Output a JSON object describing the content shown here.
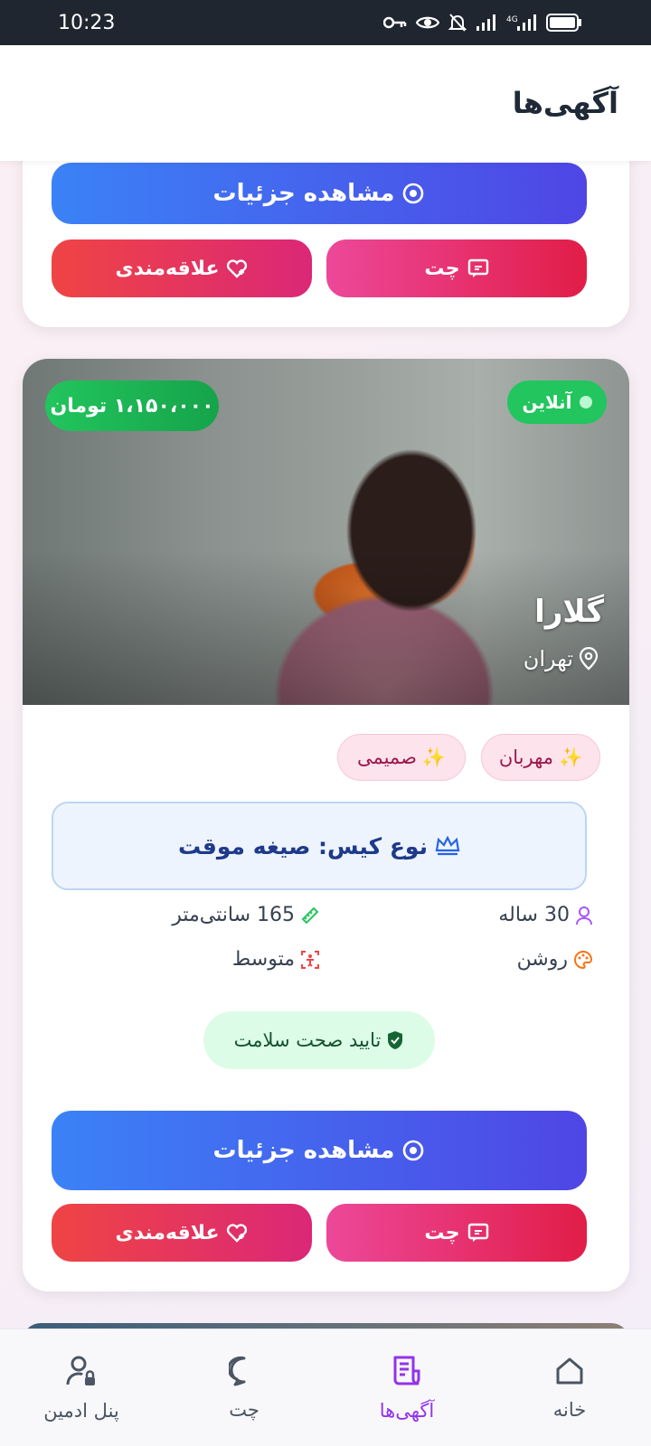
{
  "status_bar": {
    "time": "10:23",
    "icons": [
      "key-icon",
      "eye-icon",
      "bell-off-icon",
      "signal-icon",
      "4g-signal-icon",
      "battery-icon"
    ]
  },
  "app_bar": {
    "title": "آگهی‌ها"
  },
  "card_partial": {
    "details_label": "مشاهده جزئیات",
    "chat_label": "چت",
    "favorite_label": "علاقه‌مندی"
  },
  "card": {
    "status": "آنلاین",
    "price": "۱،۱۵۰،۰۰۰ تومان",
    "name": "گلارا",
    "city": "تهران",
    "tags": [
      {
        "label": "مهربان",
        "emoji": "✨"
      },
      {
        "label": "صمیمی",
        "emoji": "✨"
      }
    ],
    "case_type": "نوع کیس: صیغه موقت",
    "stats": {
      "age": "30 ساله",
      "height": "165 سانتی‌متر",
      "skin": "روشن",
      "body": "متوسط"
    },
    "health": "تایید صحت سلامت",
    "details_label": "مشاهده جزئیات",
    "chat_label": "چت",
    "favorite_label": "علاقه‌مندی"
  },
  "bottom_nav": {
    "items": [
      {
        "label": "خانه",
        "icon": "home-icon",
        "active": false
      },
      {
        "label": "آگهی‌ها",
        "icon": "document-icon",
        "active": true
      },
      {
        "label": "چت",
        "icon": "chat-bubble-icon",
        "active": false
      },
      {
        "label": "پنل ادمین",
        "icon": "admin-user-lock-icon",
        "active": false
      }
    ]
  },
  "colors": {
    "accent": "#9333ea",
    "details_gradient": [
      "#3b82f6",
      "#4f46e5"
    ],
    "chat_gradient": [
      "#ec4899",
      "#e11d48"
    ],
    "favorite_gradient": [
      "#ef4444",
      "#db2777"
    ],
    "online": "#22c55e"
  }
}
